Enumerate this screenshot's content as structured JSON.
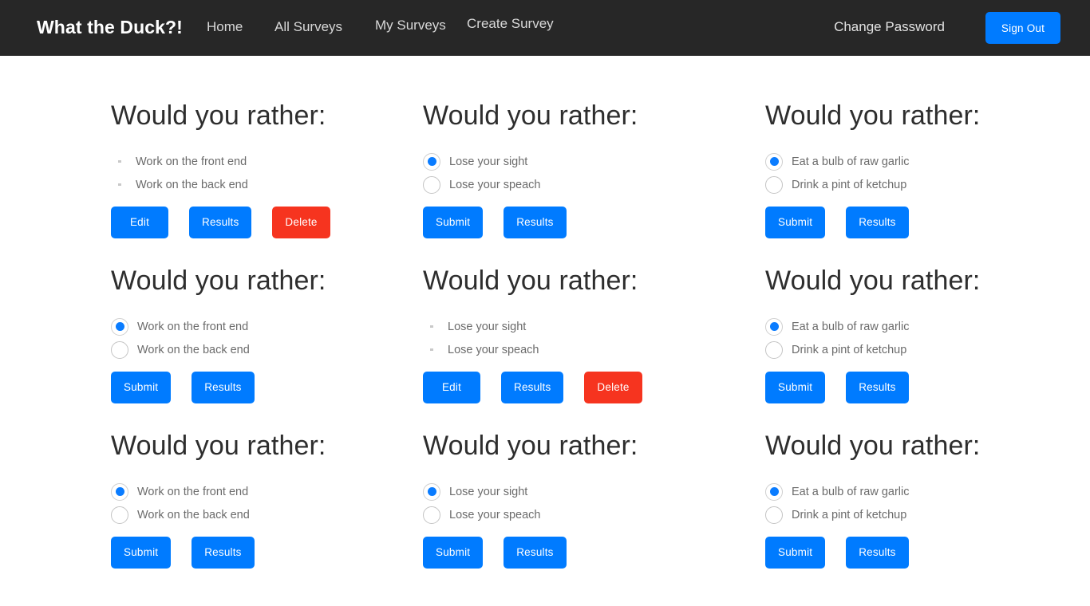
{
  "navbar": {
    "brand": "What the Duck?!",
    "links": [
      {
        "label": "Home"
      },
      {
        "label": "All Surveys"
      },
      {
        "label": "My Surveys"
      },
      {
        "label": "Create Survey"
      }
    ],
    "change_password": "Change Password",
    "sign_out": "Sign Out",
    "background_color": "#272727",
    "accent_color": "#007bff"
  },
  "colors": {
    "primary": "#007bff",
    "danger": "#f6341f",
    "radio_dot": "#0a7cff",
    "label_text": "#6b6b6b",
    "title_text": "#2e2e2e"
  },
  "buttons": {
    "edit": "Edit",
    "results": "Results",
    "delete": "Delete",
    "submit": "Submit"
  },
  "cards": [
    {
      "title": "Would you rather:",
      "mode": "list",
      "options": [
        {
          "label": "Work on the front end",
          "selected": false
        },
        {
          "label": "Work on the back end",
          "selected": false
        }
      ],
      "actions": [
        "Edit",
        "Results",
        "Delete"
      ]
    },
    {
      "title": "Would you rather:",
      "mode": "radio",
      "options": [
        {
          "label": "Lose your sight",
          "selected": true
        },
        {
          "label": "Lose your speach",
          "selected": false
        }
      ],
      "actions": [
        "Submit",
        "Results"
      ]
    },
    {
      "title": "Would you rather:",
      "mode": "radio",
      "options": [
        {
          "label": "Eat a bulb of raw garlic",
          "selected": true
        },
        {
          "label": "Drink a pint of ketchup",
          "selected": false
        }
      ],
      "actions": [
        "Submit",
        "Results"
      ]
    },
    {
      "title": "Would you rather:",
      "mode": "radio",
      "options": [
        {
          "label": "Work on the front end",
          "selected": true
        },
        {
          "label": "Work on the back end",
          "selected": false
        }
      ],
      "actions": [
        "Submit",
        "Results"
      ]
    },
    {
      "title": "Would you rather:",
      "mode": "list",
      "options": [
        {
          "label": "Lose your sight",
          "selected": false
        },
        {
          "label": "Lose your speach",
          "selected": false
        }
      ],
      "actions": [
        "Edit",
        "Results",
        "Delete"
      ]
    },
    {
      "title": "Would you rather:",
      "mode": "radio",
      "options": [
        {
          "label": "Eat a bulb of raw garlic",
          "selected": true
        },
        {
          "label": "Drink a pint of ketchup",
          "selected": false
        }
      ],
      "actions": [
        "Submit",
        "Results"
      ]
    },
    {
      "title": "Would you rather:",
      "mode": "radio",
      "options": [
        {
          "label": "Work on the front end",
          "selected": true
        },
        {
          "label": "Work on the back end",
          "selected": false
        }
      ],
      "actions": [
        "Submit",
        "Results"
      ]
    },
    {
      "title": "Would you rather:",
      "mode": "radio",
      "options": [
        {
          "label": "Lose your sight",
          "selected": true
        },
        {
          "label": "Lose your speach",
          "selected": false
        }
      ],
      "actions": [
        "Submit",
        "Results"
      ]
    },
    {
      "title": "Would you rather:",
      "mode": "radio",
      "options": [
        {
          "label": "Eat a bulb of raw garlic",
          "selected": true
        },
        {
          "label": "Drink a pint of ketchup",
          "selected": false
        }
      ],
      "actions": [
        "Submit",
        "Results"
      ]
    }
  ]
}
